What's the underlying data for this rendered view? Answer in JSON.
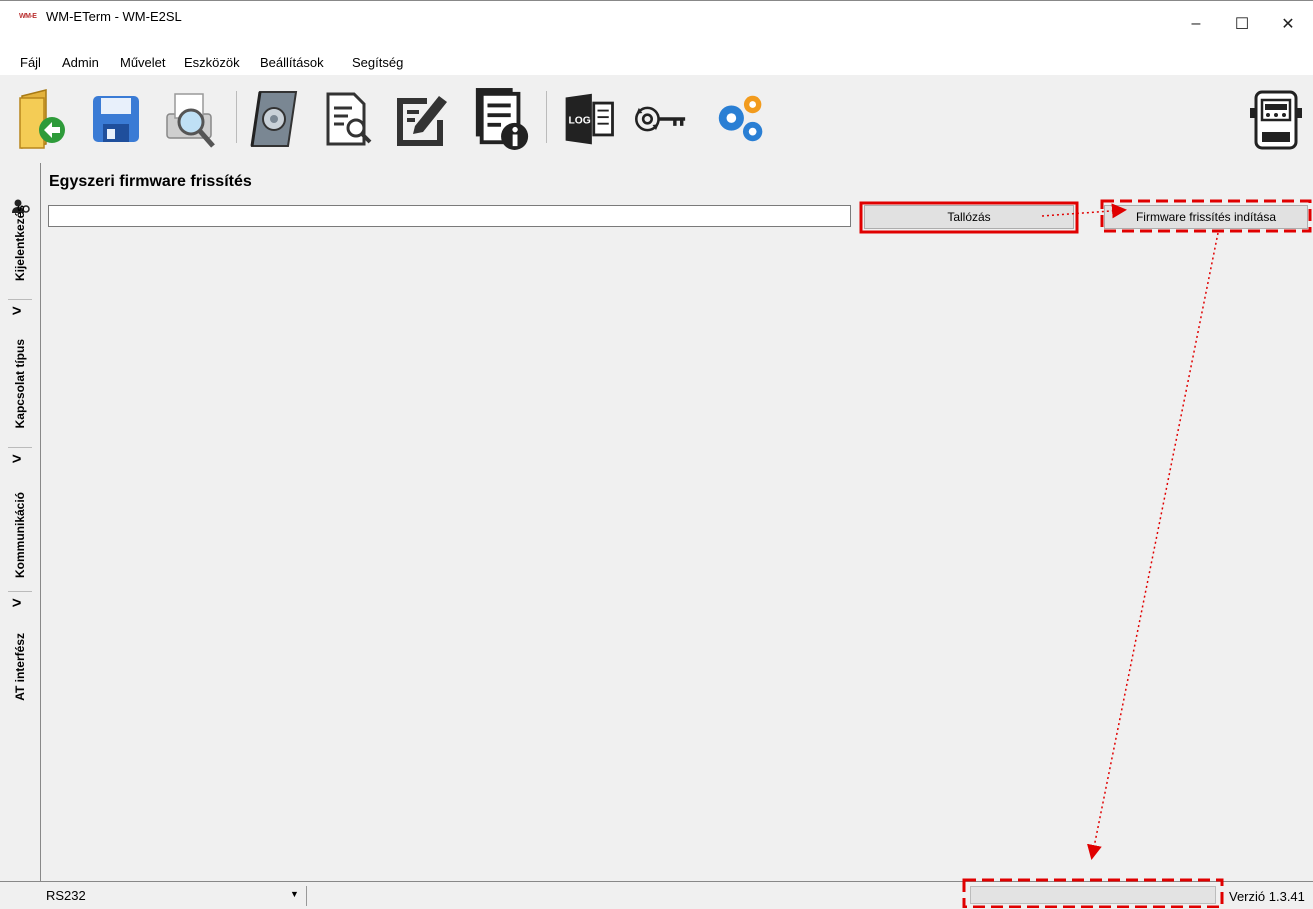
{
  "window": {
    "title": "WM-ETerm - WM-E2SL",
    "app_icon_text": "WM-E",
    "controls": {
      "minimize": "–",
      "maximize": "☐",
      "close": "✕"
    }
  },
  "menu": {
    "items": [
      "Fájl",
      "Admin",
      "Művelet",
      "Eszközök",
      "Beállítások",
      "Segítség"
    ]
  },
  "toolbar": {
    "icons": [
      "open-folder-icon",
      "save-icon",
      "print-preview-icon",
      "config-book-icon",
      "document-search-icon",
      "edit-document-icon",
      "document-info-icon",
      "log-icon",
      "key-refresh-icon",
      "gears-icon",
      "meter-icon"
    ],
    "log_text": "LOG"
  },
  "sidebar": {
    "tabs": [
      "Kijelentkezés",
      "Kapcsolat típus",
      "Kommunikáció",
      "AT interfész"
    ]
  },
  "panel": {
    "title": "Egyszeri firmware frissítés",
    "path_value": "",
    "browse_label": "Tallózás",
    "start_label": "Firmware frissítés indítása"
  },
  "statusbar": {
    "connection": "RS232",
    "version": "Verzió 1.3.41"
  },
  "colors": {
    "annotation": "#e00000",
    "accent_blue": "#2a7fd4"
  }
}
